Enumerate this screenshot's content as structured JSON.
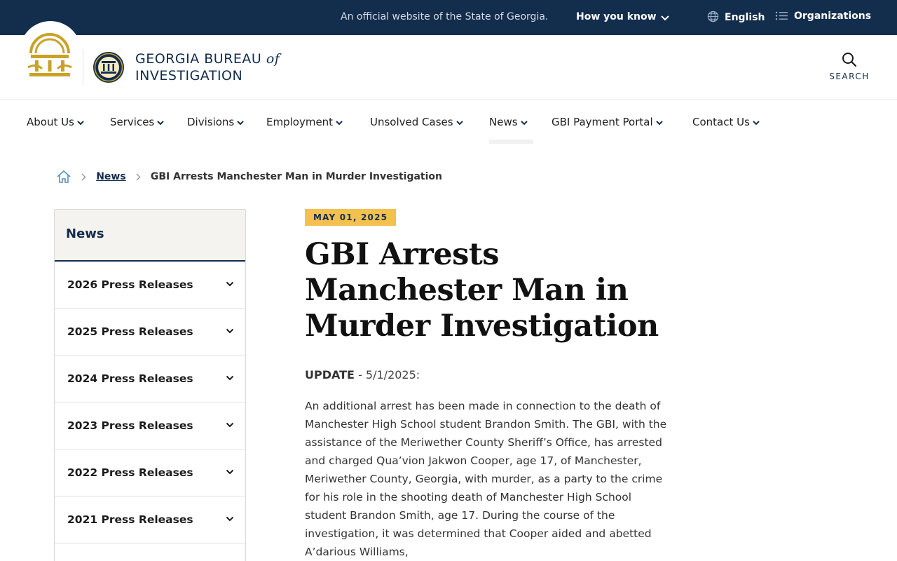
{
  "topbar": {
    "official_text": "An official website of the State of Georgia.",
    "how_you_know": "How you know",
    "language": "English",
    "organizations": "Organizations"
  },
  "header": {
    "agency_line1": "GEORGIA BUREAU",
    "agency_of": "of",
    "agency_line2": "INVESTIGATION",
    "search_label": "SEARCH"
  },
  "nav": {
    "items": [
      {
        "label": "About Us"
      },
      {
        "label": "Services"
      },
      {
        "label": "Divisions"
      },
      {
        "label": "Employment"
      },
      {
        "label": "Unsolved Cases"
      },
      {
        "label": "News",
        "active": true
      },
      {
        "label": "GBI Payment Portal"
      },
      {
        "label": "Contact Us"
      }
    ]
  },
  "breadcrumb": {
    "link": "News",
    "current": "GBI Arrests Manchester Man in Murder Investigation"
  },
  "sidebar": {
    "heading": "News",
    "items": [
      {
        "label": "2026 Press Releases"
      },
      {
        "label": "2025 Press Releases"
      },
      {
        "label": "2024 Press Releases"
      },
      {
        "label": "2023 Press Releases"
      },
      {
        "label": "2022 Press Releases"
      },
      {
        "label": "2021 Press Releases"
      }
    ]
  },
  "article": {
    "date": "MAY 01, 2025",
    "title": "GBI Arrests Manchester Man in Murder Investigation",
    "update_label": "UPDATE",
    "update_date": " - 5/1/2025:",
    "body": "An additional arrest has been made in connection to the death of Manchester High School student Brandon Smith. The GBI, with the assistance of the Meriwether County Sheriff’s Office, has arrested and charged Qua’vion Jakwon Cooper, age 17, of Manchester, Meriwether County, Georgia, with murder, as a party to the crime for his role in the shooting death of Manchester High School student Brandon Smith, age 17. During the course of the investigation, it was determined that Cooper aided and abetted A’darious Williams,"
  },
  "colors": {
    "navy": "#132d4d",
    "gold": "#c9a227",
    "badge_yellow": "#f2c14e"
  }
}
